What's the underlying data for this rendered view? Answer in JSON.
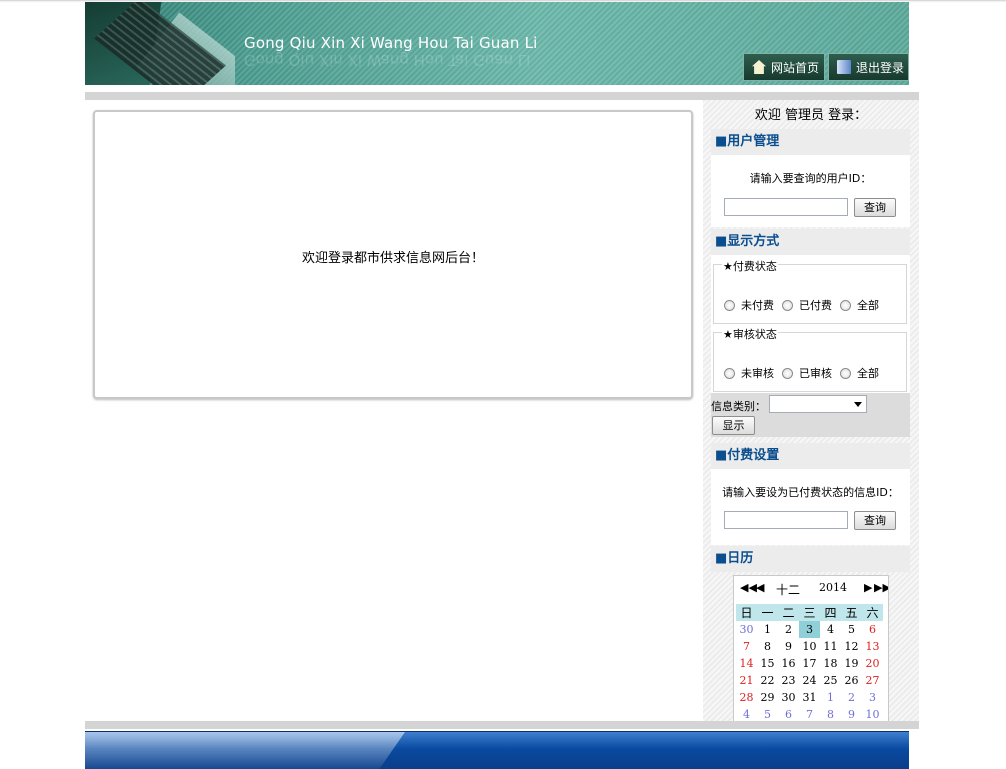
{
  "header": {
    "title": "Gong Qiu Xin Xi Wang Hou Tai Guan Li",
    "home_button": "网站首页",
    "logout_button": "退出登录"
  },
  "main": {
    "welcome_message": "欢迎登录都市供求信息网后台！"
  },
  "sidebar": {
    "welcome": "欢迎 管理员 登录：",
    "user_management": {
      "title": "■用户管理",
      "hint": "请输入要查询的用户ID：",
      "input_value": "",
      "query_button": "查询"
    },
    "display_mode": {
      "title": "■显示方式",
      "payment_status": {
        "legend": "★付费状态",
        "options": [
          "未付费",
          "已付费",
          "全部"
        ]
      },
      "review_status": {
        "legend": "★审核状态",
        "options": [
          "未审核",
          "已审核",
          "全部"
        ]
      },
      "category_label": "信息类别：",
      "category_selected": "",
      "show_button": "显示"
    },
    "payment_settings": {
      "title": "■付费设置",
      "hint": "请输入要设为已付费状态的信息ID：",
      "input_value": "",
      "query_button": "查询"
    },
    "calendar": {
      "title": "■日历",
      "month": "十二",
      "year": "2014",
      "weekdays": [
        "日",
        "一",
        "二",
        "三",
        "四",
        "五",
        "六"
      ],
      "weeks": [
        [
          "30",
          "1",
          "2",
          "3",
          "4",
          "5",
          "6"
        ],
        [
          "7",
          "8",
          "9",
          "10",
          "11",
          "12",
          "13"
        ],
        [
          "14",
          "15",
          "16",
          "17",
          "18",
          "19",
          "20"
        ],
        [
          "21",
          "22",
          "23",
          "24",
          "25",
          "26",
          "27"
        ],
        [
          "28",
          "29",
          "30",
          "31",
          "1",
          "2",
          "3"
        ],
        [
          "4",
          "5",
          "6",
          "7",
          "8",
          "9",
          "10"
        ]
      ],
      "today": "3"
    }
  },
  "colors": {
    "section_title": "#0b4e8e",
    "weekend": "#e02020",
    "other_month": "#6f6fd8",
    "today_bg": "#8fd0d8",
    "footer": "#0a4aa0"
  }
}
